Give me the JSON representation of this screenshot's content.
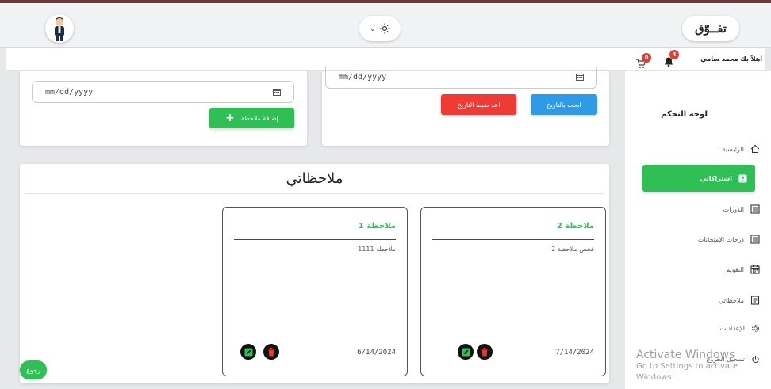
{
  "header": {
    "logo_text": "تفــوّق",
    "theme_chevron": "⌄",
    "theme_icon": "sun-icon"
  },
  "userbar": {
    "greeting": "أهلاً بك محمد سامي",
    "notifications_count": "4",
    "cart_count": "0"
  },
  "sidebar": {
    "title": "لوحة التحكم",
    "items": [
      {
        "label": "الرئيسية",
        "icon": "home-icon"
      },
      {
        "label": "اشتراكاتي",
        "icon": "id-badge-icon",
        "active": true
      },
      {
        "label": "الدورات",
        "icon": "list-icon"
      },
      {
        "label": "درجات الإمتحانات",
        "icon": "list-icon"
      },
      {
        "label": "التقويم",
        "icon": "calendar-icon"
      },
      {
        "label": "ملاحظاتي",
        "icon": "note-icon"
      },
      {
        "label": "الإعدادات",
        "icon": "gear-icon"
      },
      {
        "label": "تسجيل الخروج",
        "icon": "power-icon"
      }
    ]
  },
  "filters": {
    "left_date_placeholder": "mm/dd/yyyy",
    "add_note_label": "إضافة ملاحظة",
    "right_date_placeholder": "mm/dd/yyyy",
    "search_by_date_label": "ابحث بالتاريخ",
    "reset_date_label": "اعد ضبط التاريخ"
  },
  "notes": {
    "section_title": "ملاحظاتي",
    "items": [
      {
        "title": "ملاحظة 2",
        "body": "فحص ملاحظة 2",
        "date": "7/14/2024"
      },
      {
        "title": "ملاحظة 1",
        "body": "ملاحظة 1111",
        "date": "6/14/2024"
      }
    ]
  },
  "back_label": "رجوع",
  "watermark": {
    "line1": "Activate Windows",
    "line2": "Go to Settings to activate Windows."
  },
  "colors": {
    "accent_green": "#2fbf55",
    "search_blue": "#2f9ae6",
    "reset_red": "#ef3b33",
    "badge_red": "#e63b2e"
  }
}
